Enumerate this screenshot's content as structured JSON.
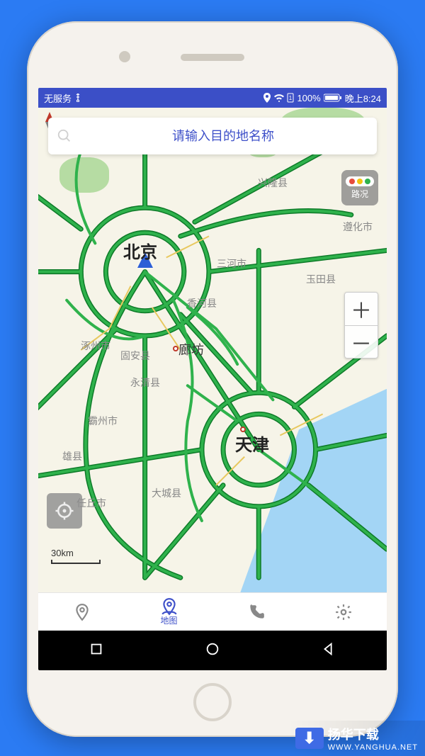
{
  "statusbar": {
    "carrier": "无服务",
    "battery": "100%",
    "time": "晚上8:24"
  },
  "search": {
    "placeholder": "请输入目的地名称"
  },
  "traffic_button": {
    "label": "路况"
  },
  "zoom": {
    "in": "＋",
    "out": "－"
  },
  "scale": {
    "label": "30km"
  },
  "map": {
    "cities": {
      "beijing": "北京",
      "tianjin": "天津",
      "langfang": "廊坊",
      "xinglong": "兴隆县",
      "zunhua": "遵化市",
      "yutian": "玉田县",
      "sanhe": "三河市",
      "xianghe": "香河县",
      "zhuozhou": "涿州市",
      "guan": "固安县",
      "yongqing": "永清县",
      "bazhou": "霸州市",
      "xiongxian": "雄县",
      "renqiu": "任丘市",
      "dacheng": "大城县"
    }
  },
  "tabs": {
    "map_label": "地图"
  },
  "watermark": {
    "text": "扬华下载",
    "sub": "WWW.YANGHUA.NET"
  },
  "colors": {
    "accent": "#3e50c9",
    "green": "#2fb24c",
    "red": "#e74c3c",
    "amber": "#f1c40f"
  }
}
